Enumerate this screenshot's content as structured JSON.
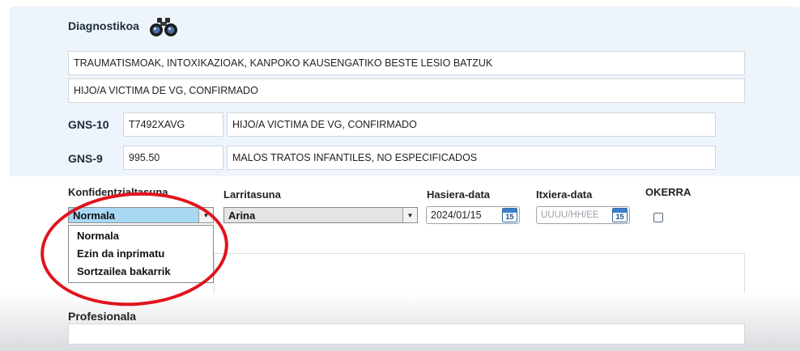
{
  "diagnosis": {
    "title": "Diagnostikoa",
    "line1": "TRAUMATISMOAK, INTOXIKAZIOAK, KANPOKO KAUSENGATIKO BESTE LESIO BATZUK",
    "line2": "HIJO/A VICTIMA DE VG, CONFIRMADO",
    "gns10": {
      "label": "GNS-10",
      "code": "T7492XAVG",
      "description": "HIJO/A VICTIMA DE VG, CONFIRMADO"
    },
    "gns9": {
      "label": "GNS-9",
      "code": "995.50",
      "description": "MALOS TRATOS INFANTILES, NO ESPECIFICADOS"
    }
  },
  "confidentiality": {
    "label": "Konfidentzialtasuna",
    "selected": "Normala",
    "options": [
      "Normala",
      "Ezin da inprimatu",
      "Sortzailea bakarrik"
    ]
  },
  "severity": {
    "label": "Larritasuna",
    "selected": "Arina"
  },
  "start_date": {
    "label": "Hasiera-data",
    "value": "2024/01/15",
    "calendar_day": "15"
  },
  "end_date": {
    "label": "Itxiera-data",
    "placeholder": "UUUU/HH/EE",
    "calendar_day": "15"
  },
  "wrong": {
    "label": "OKERRA",
    "checked": false
  },
  "professional": {
    "label": "Profesionala",
    "value": ""
  },
  "colors": {
    "panel_bg": "#eef4fb",
    "selected_option_bg": "#a8d8f4",
    "annotation_red": "#e0141c"
  }
}
